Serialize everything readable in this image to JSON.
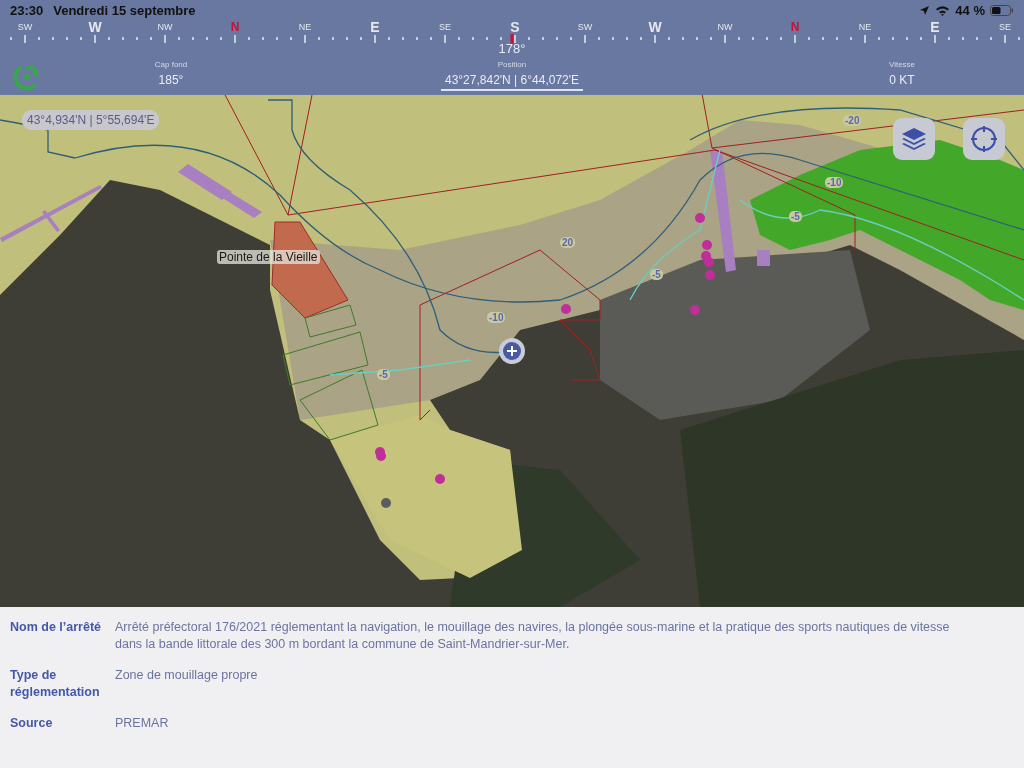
{
  "status_bar": {
    "time": "23:30",
    "date": "Vendredi 15 septembre",
    "battery": "44 %"
  },
  "compass": {
    "heading": "178°",
    "marks": [
      {
        "label": "SW",
        "kind": "minor"
      },
      {
        "label": "W",
        "kind": "major"
      },
      {
        "label": "NW",
        "kind": "minor"
      },
      {
        "label": "N",
        "kind": "north"
      },
      {
        "label": "NE",
        "kind": "minor"
      },
      {
        "label": "E",
        "kind": "major"
      },
      {
        "label": "SE",
        "kind": "minor"
      },
      {
        "label": "S",
        "kind": "major"
      },
      {
        "label": "SW",
        "kind": "minor"
      },
      {
        "label": "W",
        "kind": "major"
      },
      {
        "label": "NW",
        "kind": "minor"
      },
      {
        "label": "N",
        "kind": "north"
      },
      {
        "label": "NE",
        "kind": "minor"
      },
      {
        "label": "E",
        "kind": "major"
      },
      {
        "label": "SE",
        "kind": "minor"
      }
    ]
  },
  "readouts": [
    {
      "label": "Cap fond",
      "value": "185°",
      "selected": false
    },
    {
      "label": "Position",
      "value": "43°27,842'N | 6°44,072'E",
      "selected": true
    },
    {
      "label": "Vitesse",
      "value": "0 KT",
      "selected": false
    }
  ],
  "map": {
    "cursor_coordinates": "43°4,934'N | 5°55,694'E",
    "place_label": "Pointe de la Vieille",
    "depth_labels": [
      "-20",
      "-10",
      "-5",
      "20",
      "-5",
      "-10",
      "-5"
    ]
  },
  "details": [
    {
      "label": "Nom de l’arrêté",
      "value": "Arrêté préfectoral 176/2021 réglementant la navigation, le mouillage des navires, la plongée sous-marine et la pratique des sports nautiques de vitesse dans la bande littorale des 300 m bordant la commune de Saint-Mandrier-sur-Mer."
    },
    {
      "label": "Type de réglementation",
      "value": "Zone de mouillage propre"
    },
    {
      "label": "Source",
      "value": "PREMAR"
    }
  ]
}
